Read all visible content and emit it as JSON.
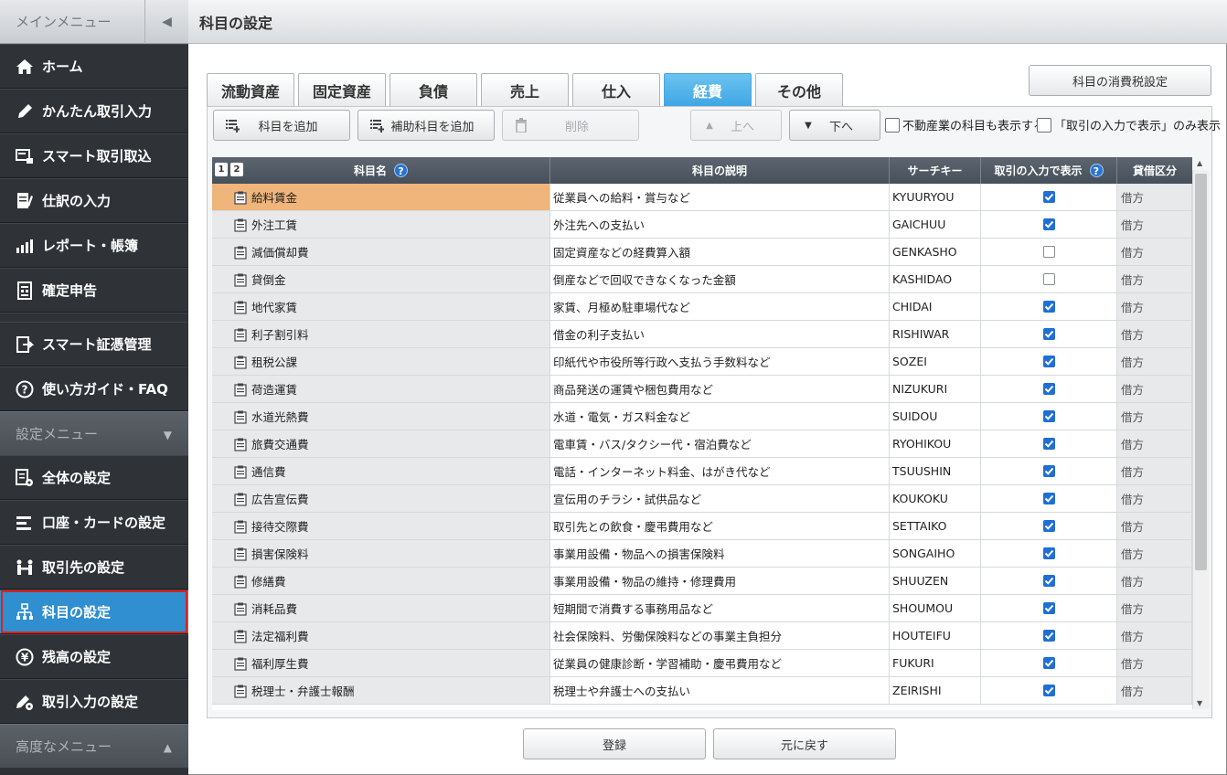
{
  "sidebar": {
    "title": "メインメニュー",
    "items": [
      {
        "label": "ホーム",
        "icon": "home-icon"
      },
      {
        "label": "かんたん取引入力",
        "icon": "pen-icon"
      },
      {
        "label": "スマート取引取込",
        "icon": "import-icon"
      },
      {
        "label": "仕訳の入力",
        "icon": "journal-icon"
      },
      {
        "label": "レポート・帳簿",
        "icon": "report-icon"
      },
      {
        "label": "確定申告",
        "icon": "tax-return-icon"
      }
    ],
    "items2": [
      {
        "label": "スマート証憑管理",
        "icon": "document-icon"
      },
      {
        "label": "使い方ガイド・FAQ",
        "icon": "help-icon"
      }
    ],
    "settings_section": "設定メニュー",
    "settings_items": [
      {
        "label": "全体の設定",
        "icon": "settings-doc-icon"
      },
      {
        "label": "口座・カードの設定",
        "icon": "account-icon"
      },
      {
        "label": "取引先の設定",
        "icon": "partner-icon"
      },
      {
        "label": "科目の設定",
        "icon": "hierarchy-icon"
      },
      {
        "label": "残高の設定",
        "icon": "yen-icon"
      },
      {
        "label": "取引入力の設定",
        "icon": "pen-gear-icon"
      }
    ],
    "advanced_section": "高度なメニュー"
  },
  "header": {
    "title": "科目の設定"
  },
  "tax_button": "科目の消費税設定",
  "tabs": [
    "流動資産",
    "固定資産",
    "負債",
    "売上",
    "仕入",
    "経費",
    "その他"
  ],
  "active_tab": "経費",
  "toolbar": {
    "add": "科目を追加",
    "add_sub": "補助科目を追加",
    "delete": "削除",
    "up": "上へ",
    "down": "下へ",
    "show_realestate": "不動産業の科目も表示する",
    "show_only_input": "「取引の入力で表示」のみ表示"
  },
  "table": {
    "headers": {
      "name": "科目名",
      "desc": "科目の説明",
      "key": "サーチキー",
      "show": "取引の入力で表示",
      "type": "貸借区分"
    },
    "sort_buttons": [
      "1",
      "2"
    ],
    "rows": [
      {
        "name": "給料賃金",
        "desc": "従業員への給料・賞与など",
        "key": "KYUURYOU",
        "show": true,
        "type": "借方"
      },
      {
        "name": "外注工賃",
        "desc": "外注先への支払い",
        "key": "GAICHUU",
        "show": true,
        "type": "借方"
      },
      {
        "name": "減価償却費",
        "desc": "固定資産などの経費算入額",
        "key": "GENKASHO",
        "show": false,
        "type": "借方"
      },
      {
        "name": "貸倒金",
        "desc": "倒産などで回収できなくなった金額",
        "key": "KASHIDAO",
        "show": false,
        "type": "借方"
      },
      {
        "name": "地代家賃",
        "desc": "家賃、月極め駐車場代など",
        "key": "CHIDAI",
        "show": true,
        "type": "借方"
      },
      {
        "name": "利子割引料",
        "desc": "借金の利子支払い",
        "key": "RISHIWAR",
        "show": true,
        "type": "借方"
      },
      {
        "name": "租税公課",
        "desc": "印紙代や市役所等行政へ支払う手数料など",
        "key": "SOZEI",
        "show": true,
        "type": "借方"
      },
      {
        "name": "荷造運賃",
        "desc": "商品発送の運賃や梱包費用など",
        "key": "NIZUKURI",
        "show": true,
        "type": "借方"
      },
      {
        "name": "水道光熱費",
        "desc": "水道・電気・ガス料金など",
        "key": "SUIDOU",
        "show": true,
        "type": "借方"
      },
      {
        "name": "旅費交通費",
        "desc": "電車賃・バス/タクシー代・宿泊費など",
        "key": "RYOHIKOU",
        "show": true,
        "type": "借方"
      },
      {
        "name": "通信費",
        "desc": "電話・インターネット料金、はがき代など",
        "key": "TSUUSHIN",
        "show": true,
        "type": "借方"
      },
      {
        "name": "広告宣伝費",
        "desc": "宣伝用のチラシ・試供品など",
        "key": "KOUKOKU",
        "show": true,
        "type": "借方"
      },
      {
        "name": "接待交際費",
        "desc": "取引先との飲食・慶弔費用など",
        "key": "SETTAIKO",
        "show": true,
        "type": "借方"
      },
      {
        "name": "損害保険料",
        "desc": "事業用設備・物品への損害保険料",
        "key": "SONGAIHO",
        "show": true,
        "type": "借方"
      },
      {
        "name": "修繕費",
        "desc": "事業用設備・物品の維持・修理費用",
        "key": "SHUUZEN",
        "show": true,
        "type": "借方"
      },
      {
        "name": "消耗品費",
        "desc": "短期間で消費する事務用品など",
        "key": "SHOUMOU",
        "show": true,
        "type": "借方"
      },
      {
        "name": "法定福利費",
        "desc": "社会保険料、労働保険料などの事業主負担分",
        "key": "HOUTEIFU",
        "show": true,
        "type": "借方"
      },
      {
        "name": "福利厚生費",
        "desc": "従業員の健康診断・学習補助・慶弔費用など",
        "key": "FUKURI",
        "show": true,
        "type": "借方"
      },
      {
        "name": "税理士・弁護士報酬",
        "desc": "税理士や弁護士への支払い",
        "key": "ZEIRISHI",
        "show": true,
        "type": "借方"
      }
    ]
  },
  "footer": {
    "register": "登録",
    "revert": "元に戻す"
  },
  "colors": {
    "active_tab": "#3fa7e4",
    "selected_row": "#efb57a",
    "sidebar_active": "#2f8fd0"
  }
}
